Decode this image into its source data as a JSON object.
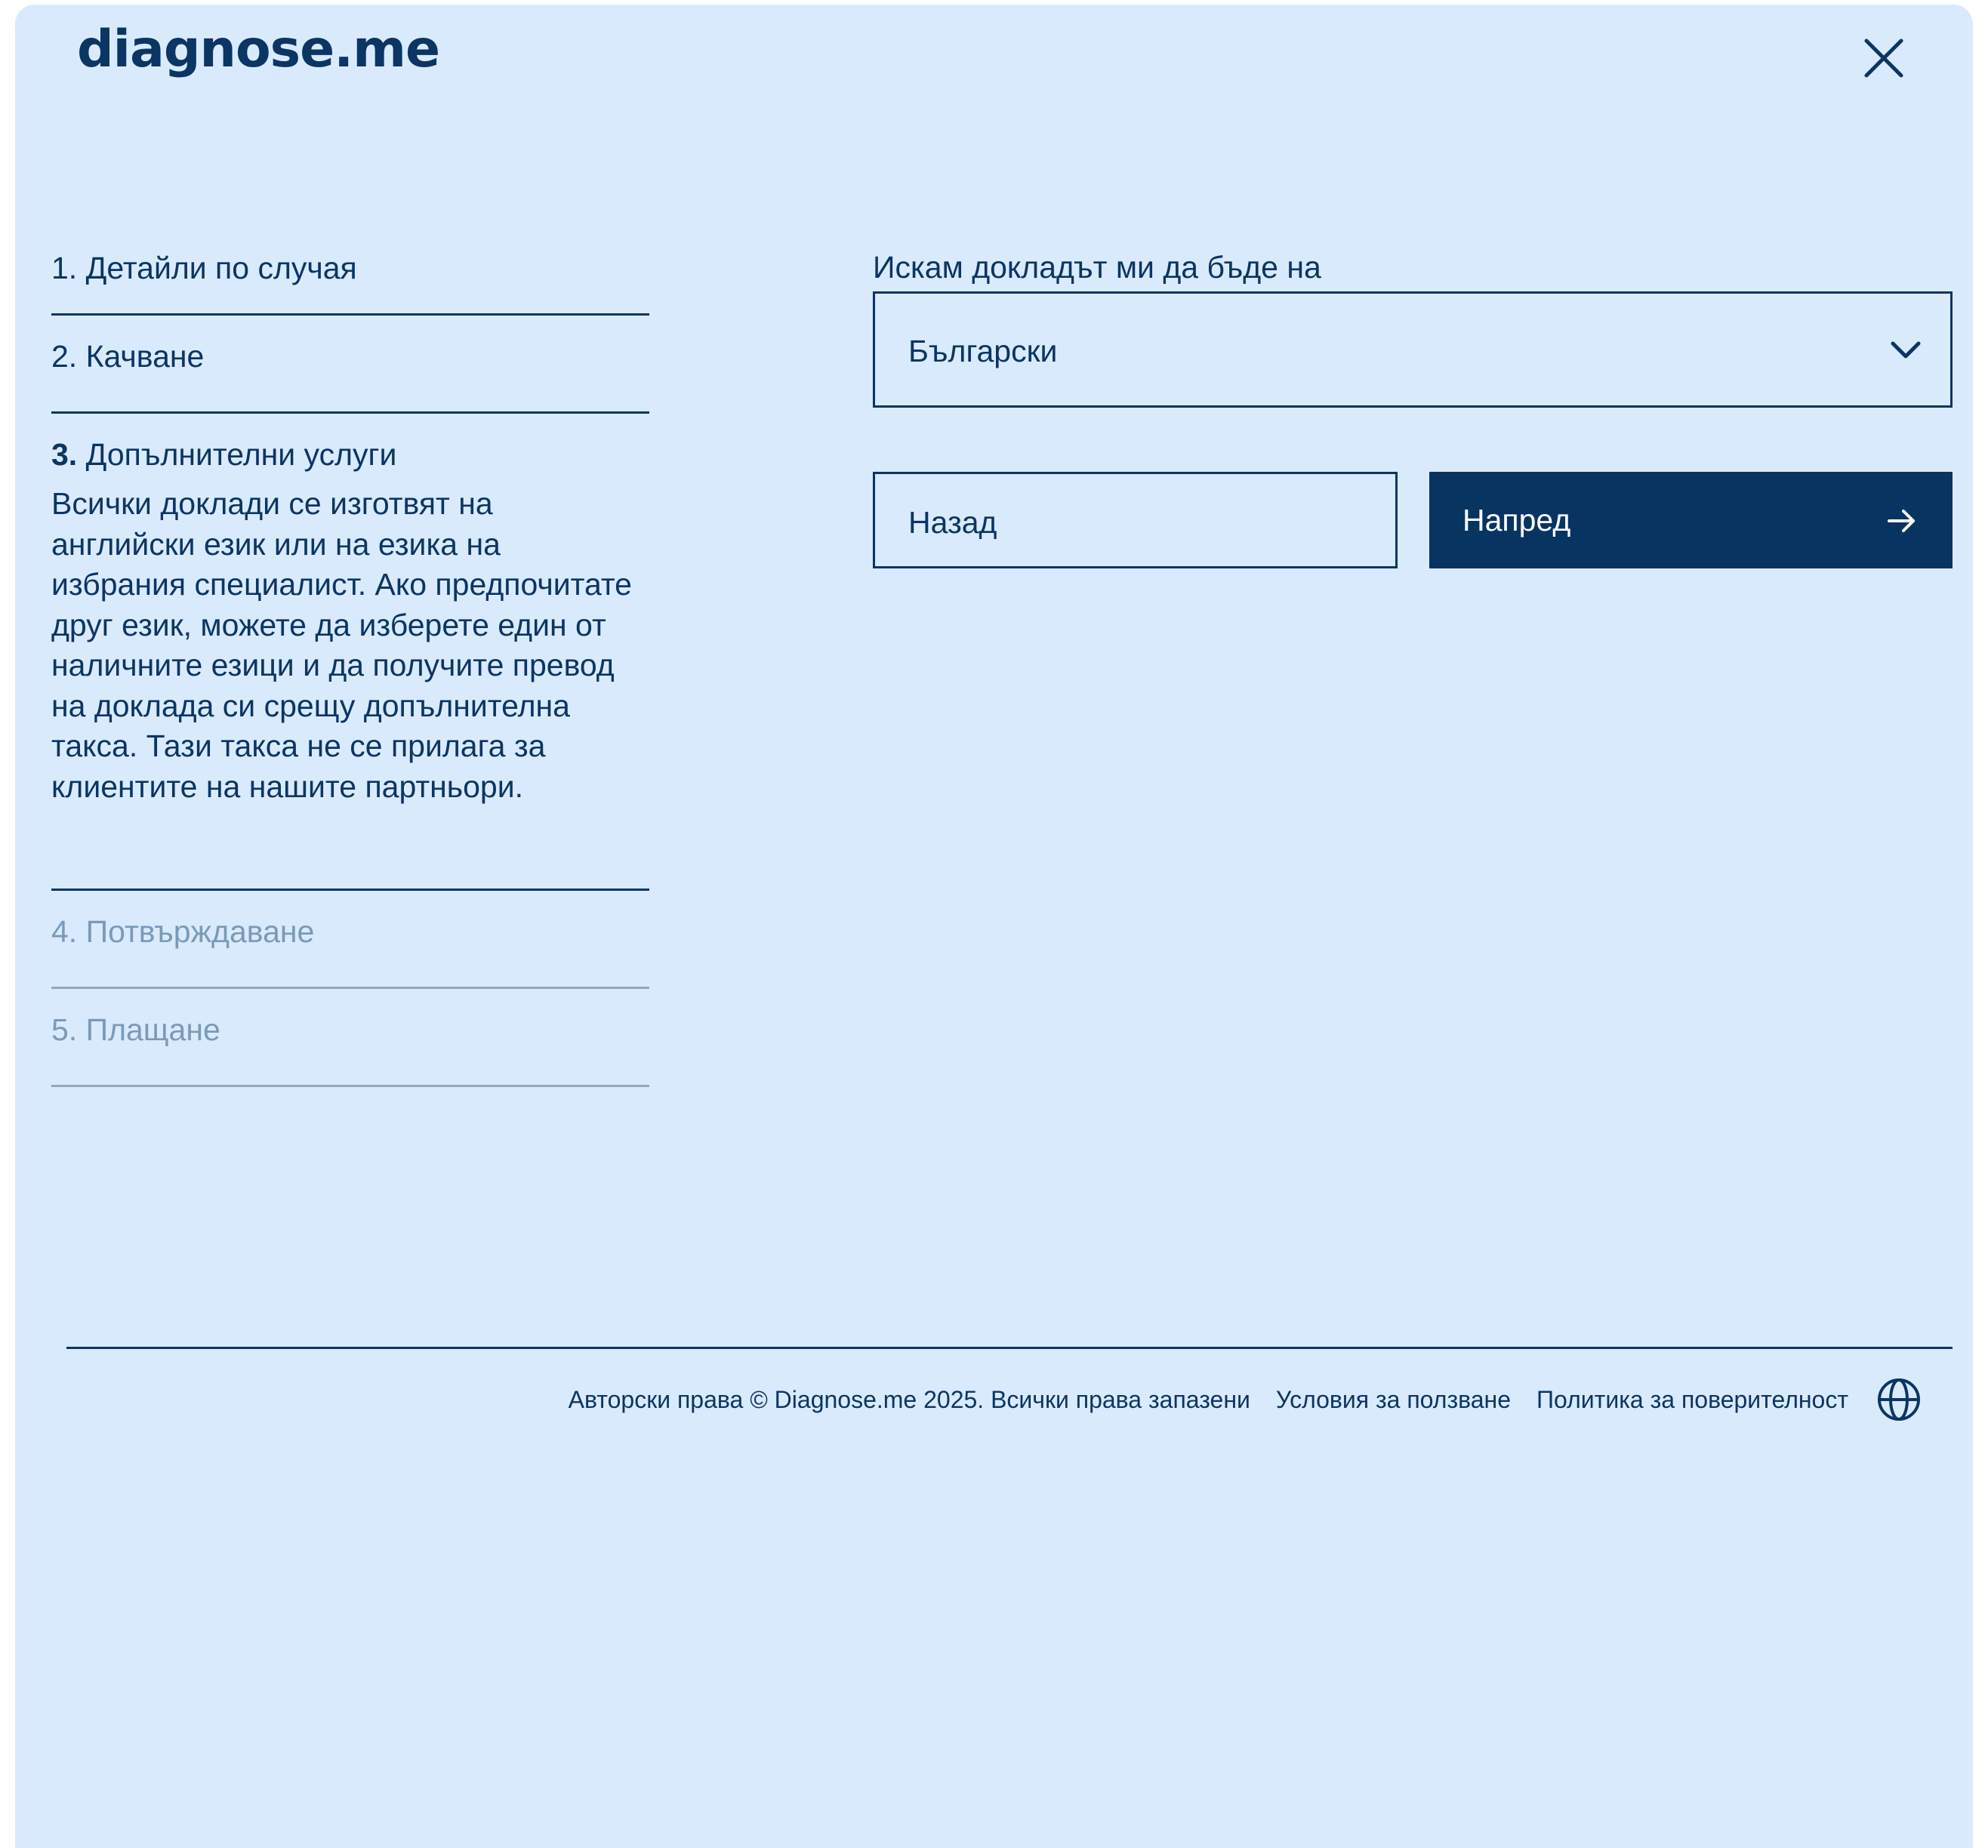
{
  "brand": {
    "logo_text": "diagnose.me"
  },
  "steps": [
    {
      "number": "1.",
      "title": "Детайли по случая",
      "state": "completed"
    },
    {
      "number": "2.",
      "title": "Качване",
      "state": "completed"
    },
    {
      "number": "3.",
      "title": "Допълнителни услуги",
      "state": "active",
      "description": "Всички доклади се изготвят на английски език или на езика на избрания специалист. Ако предпочитате друг език, можете да изберете един от наличните езици и да получите превод на доклада си срещу допълнителна такса. Тази такса не се прилага за клиентите на нашите партньори."
    },
    {
      "number": "4.",
      "title": "Потвърждаване",
      "state": "disabled"
    },
    {
      "number": "5.",
      "title": "Плащане",
      "state": "disabled"
    }
  ],
  "form": {
    "language_label": "Искам докладът ми да бъде на",
    "language_value": "Български",
    "back_label": "Назад",
    "next_label": "Напред"
  },
  "footer": {
    "copyright": "Авторски права © Diagnose.me 2025. Всички права запазени",
    "terms": "Условия за ползване",
    "privacy": "Политика за поверителност"
  },
  "icons": {
    "close": "close-icon",
    "dropdown": "chevron-down-icon",
    "next": "arrow-right-icon",
    "language": "globe-icon"
  },
  "colors": {
    "background": "#d9eafc",
    "primary": "#0b3563",
    "primary_button": "#083462",
    "disabled_text": "#7a9ab8"
  }
}
